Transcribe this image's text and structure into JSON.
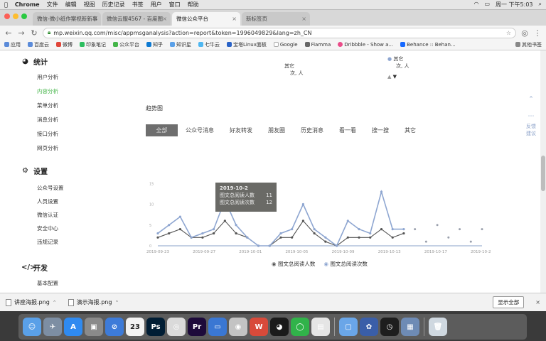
{
  "menubar": {
    "apple": "",
    "app_name": "Chrome",
    "items": [
      "文件",
      "编辑",
      "视图",
      "历史记录",
      "书签",
      "用户",
      "窗口",
      "帮助"
    ],
    "status": "周一 下午5:03"
  },
  "tabs": [
    {
      "label": "微信-微小纸作案视新新事",
      "active": false
    },
    {
      "label": "微信云服4567 - 百度图",
      "active": false
    },
    {
      "label": "微信公众平台",
      "active": true
    },
    {
      "label": "新标签页",
      "active": false
    }
  ],
  "toolbar": {
    "url": "mp.weixin.qq.com/misc/appmsganalysis?action=report&token=1996049829&lang=zh_CN"
  },
  "bookmarks": {
    "items": [
      "应用",
      "百度云",
      "微博",
      "印象笔记",
      "公众平台",
      "知乎",
      "知识星",
      "七牛云",
      "宝塔Linux面板",
      "Google",
      "Fiamma",
      "Dribbble - Show a...",
      "Behance :: Behan..."
    ],
    "other": "其他书签"
  },
  "sidebar": {
    "stats": {
      "title": "统计",
      "items": [
        "用户分析",
        "内容分析",
        "菜单分析",
        "消息分析",
        "接口分析",
        "网页分析"
      ]
    },
    "settings": {
      "title": "设置",
      "items": [
        "公众号设置",
        "人员设置",
        "微信认证",
        "安全中心",
        "违规记录"
      ]
    },
    "dev": {
      "title": "开发",
      "items": [
        "基本配置"
      ]
    }
  },
  "top_legend": {
    "left_label": "其它",
    "left_value": "次, 人",
    "right_label": "其它",
    "right_value": "次, 人",
    "arrow_up": "▲",
    "arrow_down": "▼"
  },
  "trend": {
    "title": "趋势图",
    "filters": [
      "全部",
      "公众号消息",
      "好友转发",
      "朋友圈",
      "历史消息",
      "看一看",
      "搜一搜",
      "其它"
    ],
    "active_filter": 0
  },
  "tooltip": {
    "date": "2019-10-2",
    "rows": [
      {
        "label": "图文总阅读人数",
        "value": "11"
      },
      {
        "label": "图文总阅读次数",
        "value": "12"
      }
    ]
  },
  "right_float": {
    "label": "反馈\n建议"
  },
  "chart_data": {
    "type": "line",
    "x_ticks": [
      "2019-09-23",
      "2019-09-27",
      "2019-10-01",
      "2019-10-05",
      "2019-10-09",
      "2019-10-13",
      "2019-10-17",
      "2019-10-21"
    ],
    "y_ticks": [
      "",
      "15",
      "10",
      "5",
      "0"
    ],
    "ylim": [
      0,
      20
    ],
    "x_index_range": [
      0,
      29
    ],
    "series": [
      {
        "name": "图文总阅读人数",
        "color": "#555555",
        "values": [
          2,
          3,
          4,
          2,
          2,
          3,
          6,
          3,
          2,
          0,
          0,
          2,
          2,
          6,
          3,
          1,
          0,
          2,
          2,
          2,
          4,
          2,
          3
        ]
      },
      {
        "name": "图文总阅读次数",
        "color": "#8ea6d1",
        "values": [
          3,
          5,
          7,
          2,
          3,
          4,
          11,
          5,
          2,
          0,
          0,
          3,
          4,
          10,
          4,
          2,
          0,
          6,
          4,
          3,
          13,
          4,
          4
        ]
      }
    ],
    "projection_dots": [
      {
        "x": 23,
        "y": 4
      },
      {
        "x": 24,
        "y": 1
      },
      {
        "x": 25,
        "y": 5
      },
      {
        "x": 26,
        "y": 2
      },
      {
        "x": 27,
        "y": 4
      },
      {
        "x": 28,
        "y": 1
      },
      {
        "x": 29,
        "y": 4
      }
    ],
    "legend_position": "bottom"
  },
  "downloads": {
    "files": [
      "讲座海报.png",
      "演示海报.png"
    ],
    "show_all": "显示全部"
  },
  "dock": {
    "apps": [
      "Finder",
      "Launchpad",
      "App Store",
      "Preview",
      "Safari",
      "Calendar",
      "Photoshop",
      "Chrome",
      "Premiere",
      "Keynote",
      "Finder2",
      "WPS",
      "QQ",
      "WeChat",
      "Docs",
      "Folder",
      "Grid",
      "Clock",
      "Gallery",
      "Trash"
    ],
    "calendar_day": "23"
  },
  "colors": {
    "accent": "#44b549",
    "line_dark": "#555555",
    "line_light": "#8ea6d1"
  }
}
